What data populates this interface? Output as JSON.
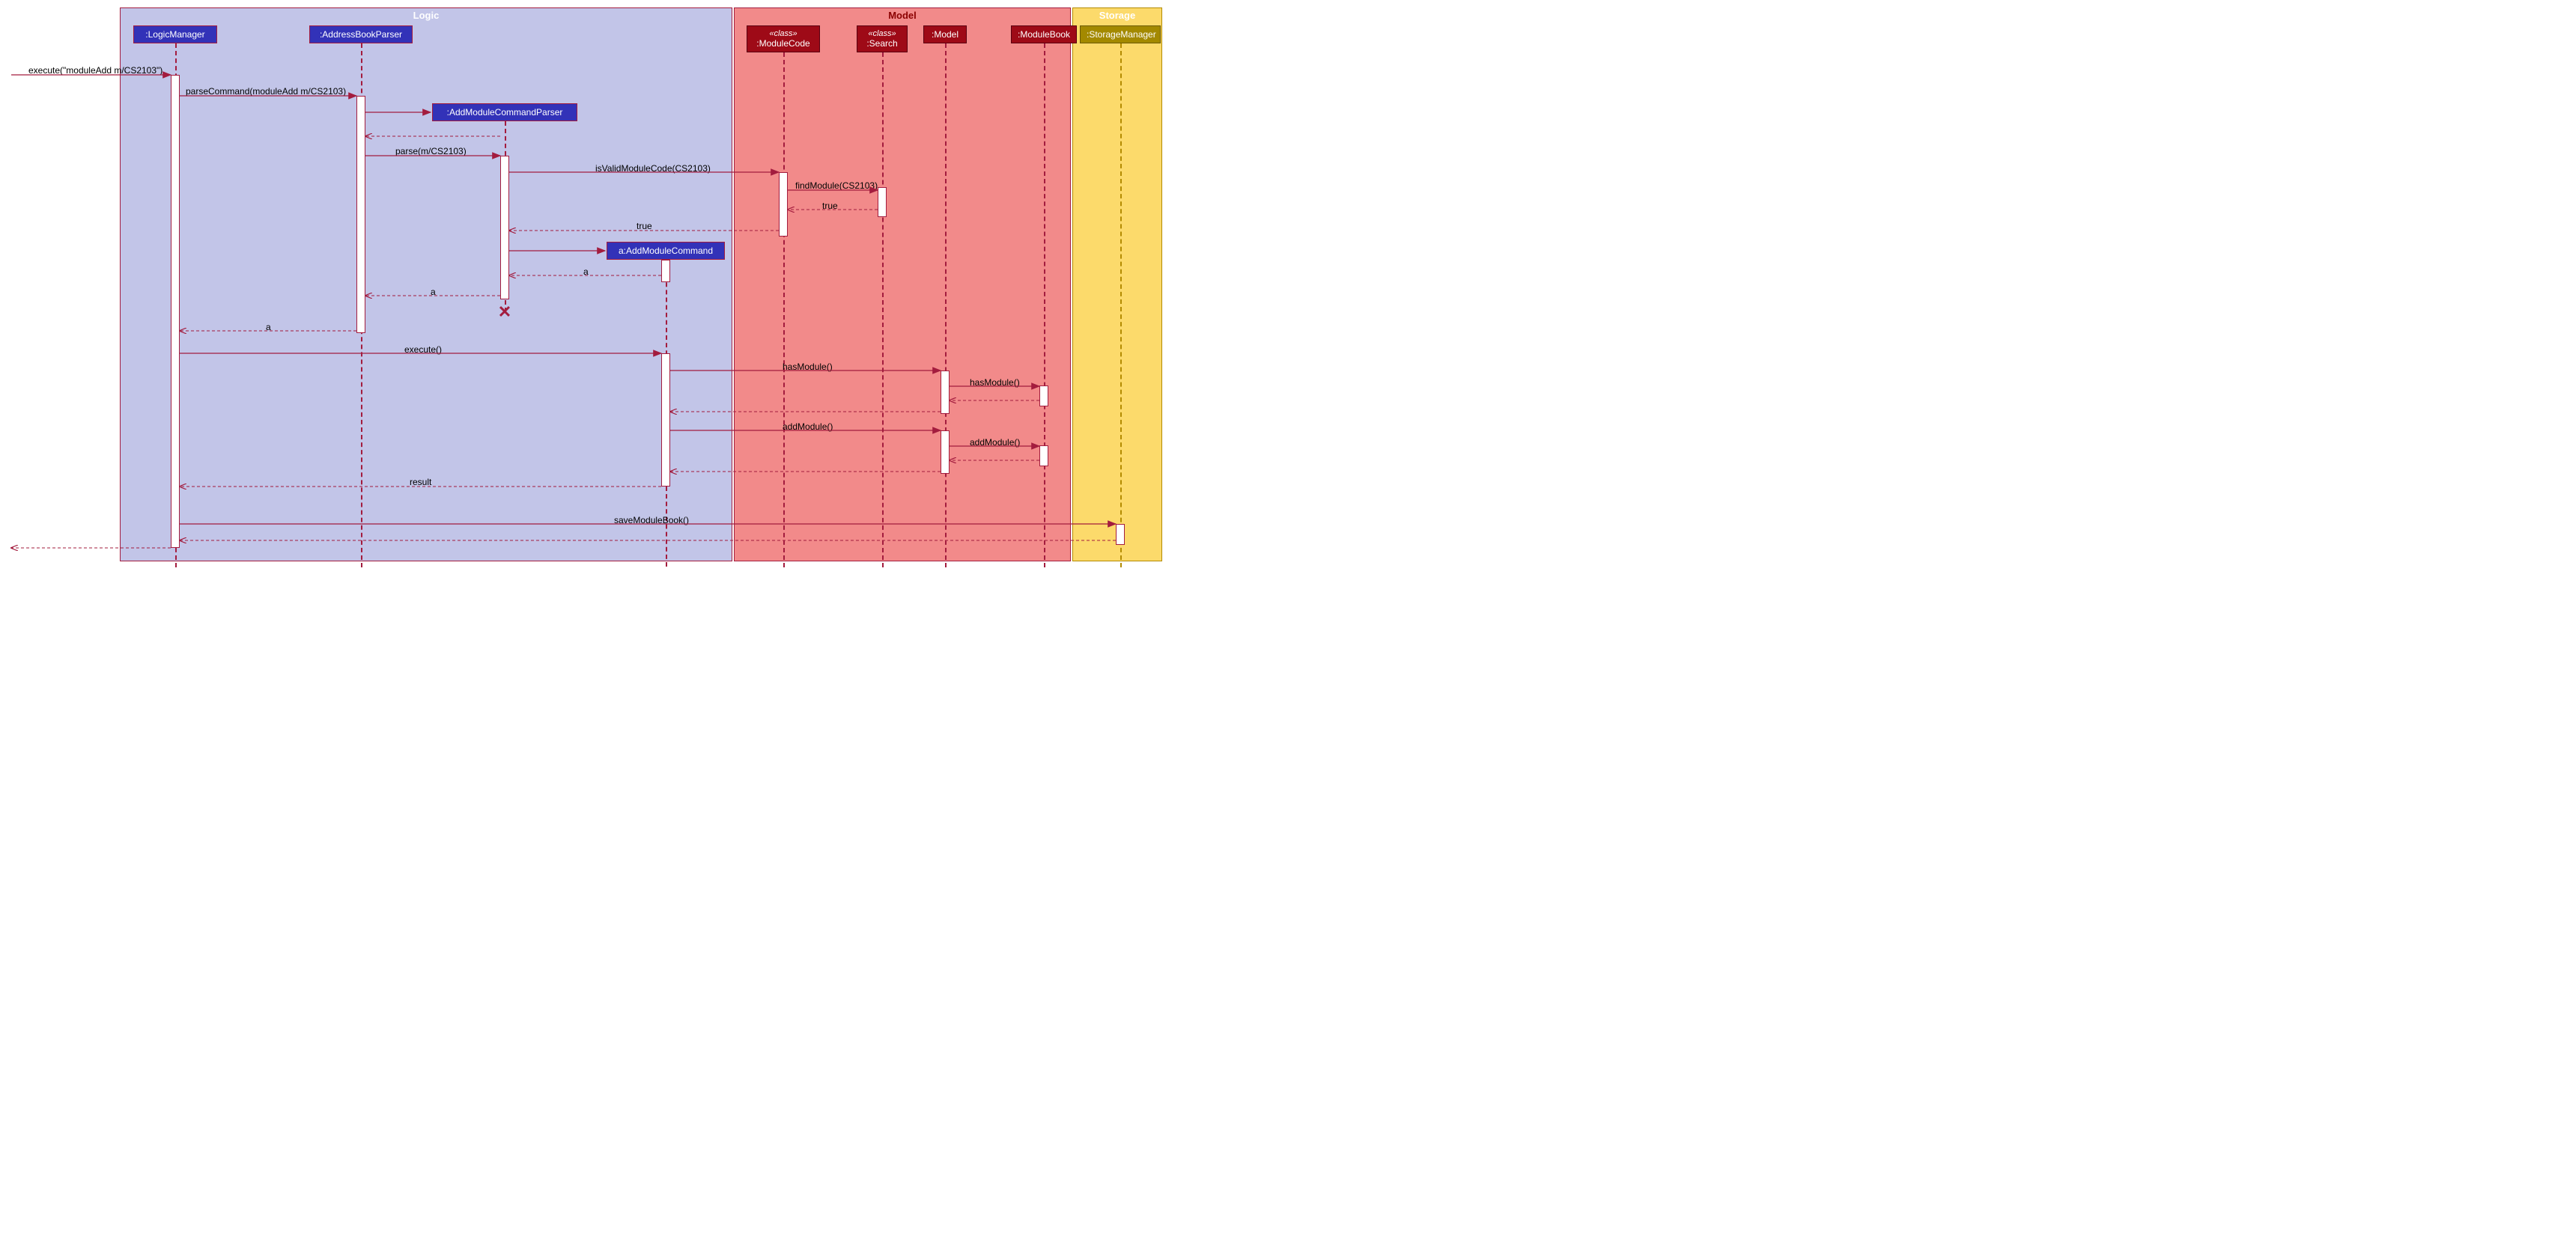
{
  "regions": {
    "logic": {
      "title": "Logic"
    },
    "model": {
      "title": "Model"
    },
    "storage": {
      "title": "Storage"
    }
  },
  "participants": {
    "logicManager": {
      "label": ":LogicManager"
    },
    "addressBookParser": {
      "label": ":AddressBookParser"
    },
    "addModuleCommandParser": {
      "label": ":AddModuleCommandParser"
    },
    "addModuleCommand": {
      "label": "a:AddModuleCommand"
    },
    "moduleCode": {
      "stereo": "«class»",
      "label": ":ModuleCode"
    },
    "search": {
      "stereo": "«class»",
      "label": ":Search"
    },
    "model": {
      "label": ":Model"
    },
    "moduleBook": {
      "label": ":ModuleBook"
    },
    "storageManager": {
      "label": ":StorageManager"
    }
  },
  "messages": {
    "m1": "execute(\"moduleAdd m/CS2103\")",
    "m2": "parseCommand(moduleAdd m/CS2103)",
    "m3": "parse(m/CS2103)",
    "m4": "isValidModuleCode(CS2103)",
    "m5": "findModule(CS2103)",
    "m6": "true",
    "m7": "true",
    "m8": "a",
    "m9": "a",
    "m10": "a",
    "m11": "execute()",
    "m12": "hasModule()",
    "m13": "hasModule()",
    "m14": "addModule()",
    "m15": "addModule()",
    "m16": "result",
    "m17": "saveModuleBook()"
  }
}
